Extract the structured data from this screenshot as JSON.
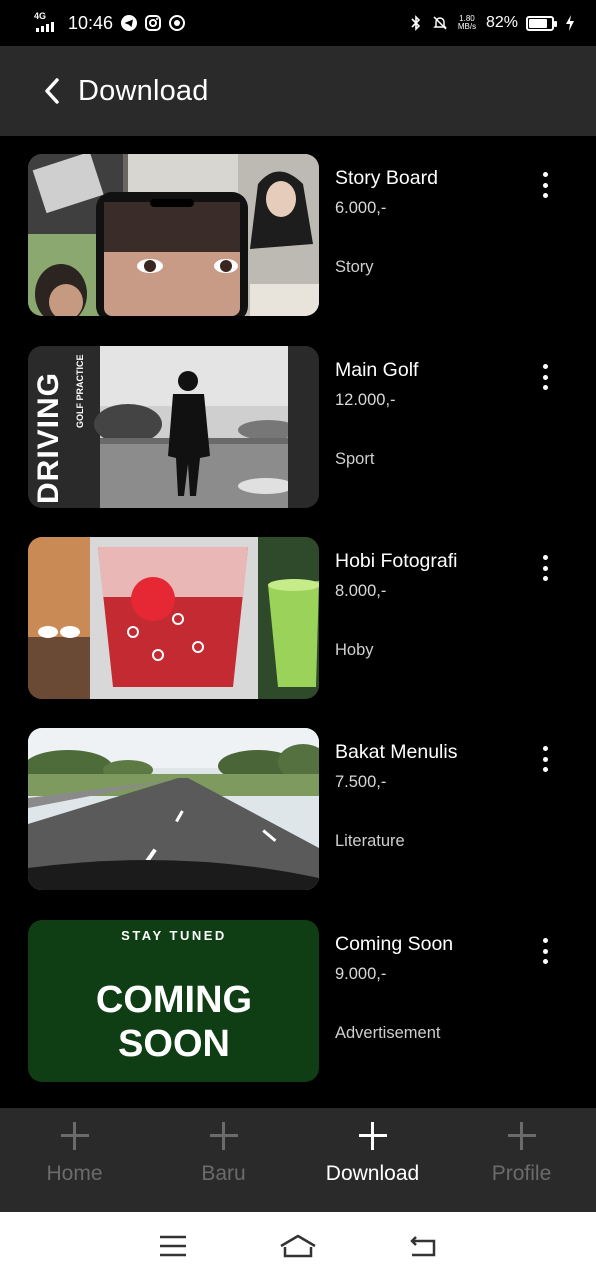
{
  "status_bar": {
    "network": "4G",
    "time": "10:46",
    "net_speed_value": "1.80",
    "net_speed_unit": "MB/s",
    "battery": "82%",
    "battery_level": 0.82
  },
  "header": {
    "title": "Download"
  },
  "items": [
    {
      "title": "Story Board",
      "price": "6.000,-",
      "category": "Story"
    },
    {
      "title": "Main Golf",
      "price": "12.000,-",
      "category": "Sport"
    },
    {
      "title": "Hobi Fotografi",
      "price": "8.000,-",
      "category": "Hoby"
    },
    {
      "title": "Bakat Menulis",
      "price": "7.500,-",
      "category": "Literature"
    },
    {
      "title": "Coming Soon",
      "price": "9.000,-",
      "category": "Advertisement"
    }
  ],
  "thumb_text": {
    "driving": "DRIVING",
    "golf_practice": "GOLF PRACTICE",
    "stay_tuned": "STAY TUNED",
    "coming": "COMING",
    "soon": "SOON"
  },
  "bottom_nav": [
    {
      "label": "Home",
      "active": false
    },
    {
      "label": "Baru",
      "active": false
    },
    {
      "label": "Download",
      "active": true
    },
    {
      "label": "Profile",
      "active": false
    }
  ],
  "colors": {
    "background": "#000000",
    "header": "#2a2a2a",
    "nav_inactive": "#6b6b6b",
    "coming_soon_bg": "#0f3d14"
  }
}
